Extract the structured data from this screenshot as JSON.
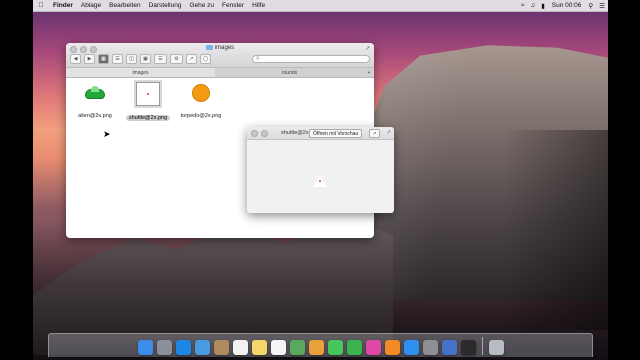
{
  "menubar": {
    "apple_icon": "apple-icon",
    "items": [
      "Finder",
      "Ablage",
      "Bearbeiten",
      "Darstellung",
      "Gehe zu",
      "Fenster",
      "Hilfe"
    ],
    "status_icons": [
      "wifi-icon",
      "battery-icon",
      "volume-icon",
      "search-icon",
      "list-icon"
    ],
    "clock": "Sun 00:06"
  },
  "finder": {
    "title": "images",
    "search_placeholder": "",
    "tabs": [
      "images",
      "rounds"
    ],
    "tab_add": "+",
    "files": [
      {
        "name": "alien@2x.png",
        "icon": "alien-thumbnail"
      },
      {
        "name": "shuttle@2x.png",
        "icon": "shuttle-thumbnail",
        "selected": true
      },
      {
        "name": "torpedo@2x.png",
        "icon": "torpedo-thumbnail"
      }
    ]
  },
  "quicklook": {
    "title": "shuttle@2x.png",
    "open_button": "Öffnen mit Vorschau",
    "share_icon": "share-icon",
    "fullscreen_icon": "fullscreen-icon"
  },
  "dock": {
    "icons": [
      "finder",
      "launchpad",
      "safari",
      "mail",
      "contacts",
      "calendar",
      "notes",
      "reminders",
      "maps",
      "photos",
      "messages",
      "facetime",
      "itunes",
      "ibooks",
      "appstore",
      "preferences",
      "xcode",
      "terminal",
      "trash"
    ],
    "colors": [
      "#3b8ee8",
      "#8a8f99",
      "#1d87e6",
      "#4a9ae0",
      "#b08a5c",
      "#f2f2f2",
      "#f3d56b",
      "#f4f4f4",
      "#5aa75f",
      "#e7a03a",
      "#45c55b",
      "#3cb34f",
      "#e048a6",
      "#f28b25",
      "#2f8ff0",
      "#8d8f94",
      "#4473c9",
      "#2b2b2b",
      "#b7bcc4"
    ]
  }
}
